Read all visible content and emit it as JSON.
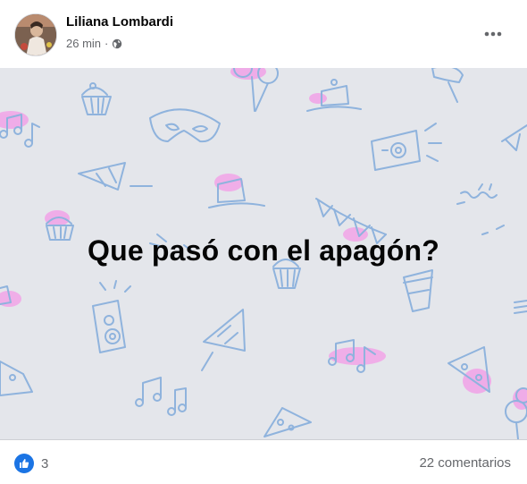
{
  "post": {
    "author": "Liliana Lombardi",
    "time": "26 min",
    "separator": "·",
    "privacy_icon": "globe-icon",
    "more_icon": "ellipsis-icon",
    "headline": "Que pasó con el apagón?"
  },
  "footer": {
    "reaction_icon": "like-icon",
    "reaction_count": "3",
    "comments": "22 comentarios"
  },
  "colors": {
    "background_pattern": "#e4e6eb",
    "doodle_stroke": "#8fb3dd",
    "doodle_accent": "#f2a3e8",
    "like_blue": "#1b74e4",
    "secondary_text": "#65676b"
  }
}
